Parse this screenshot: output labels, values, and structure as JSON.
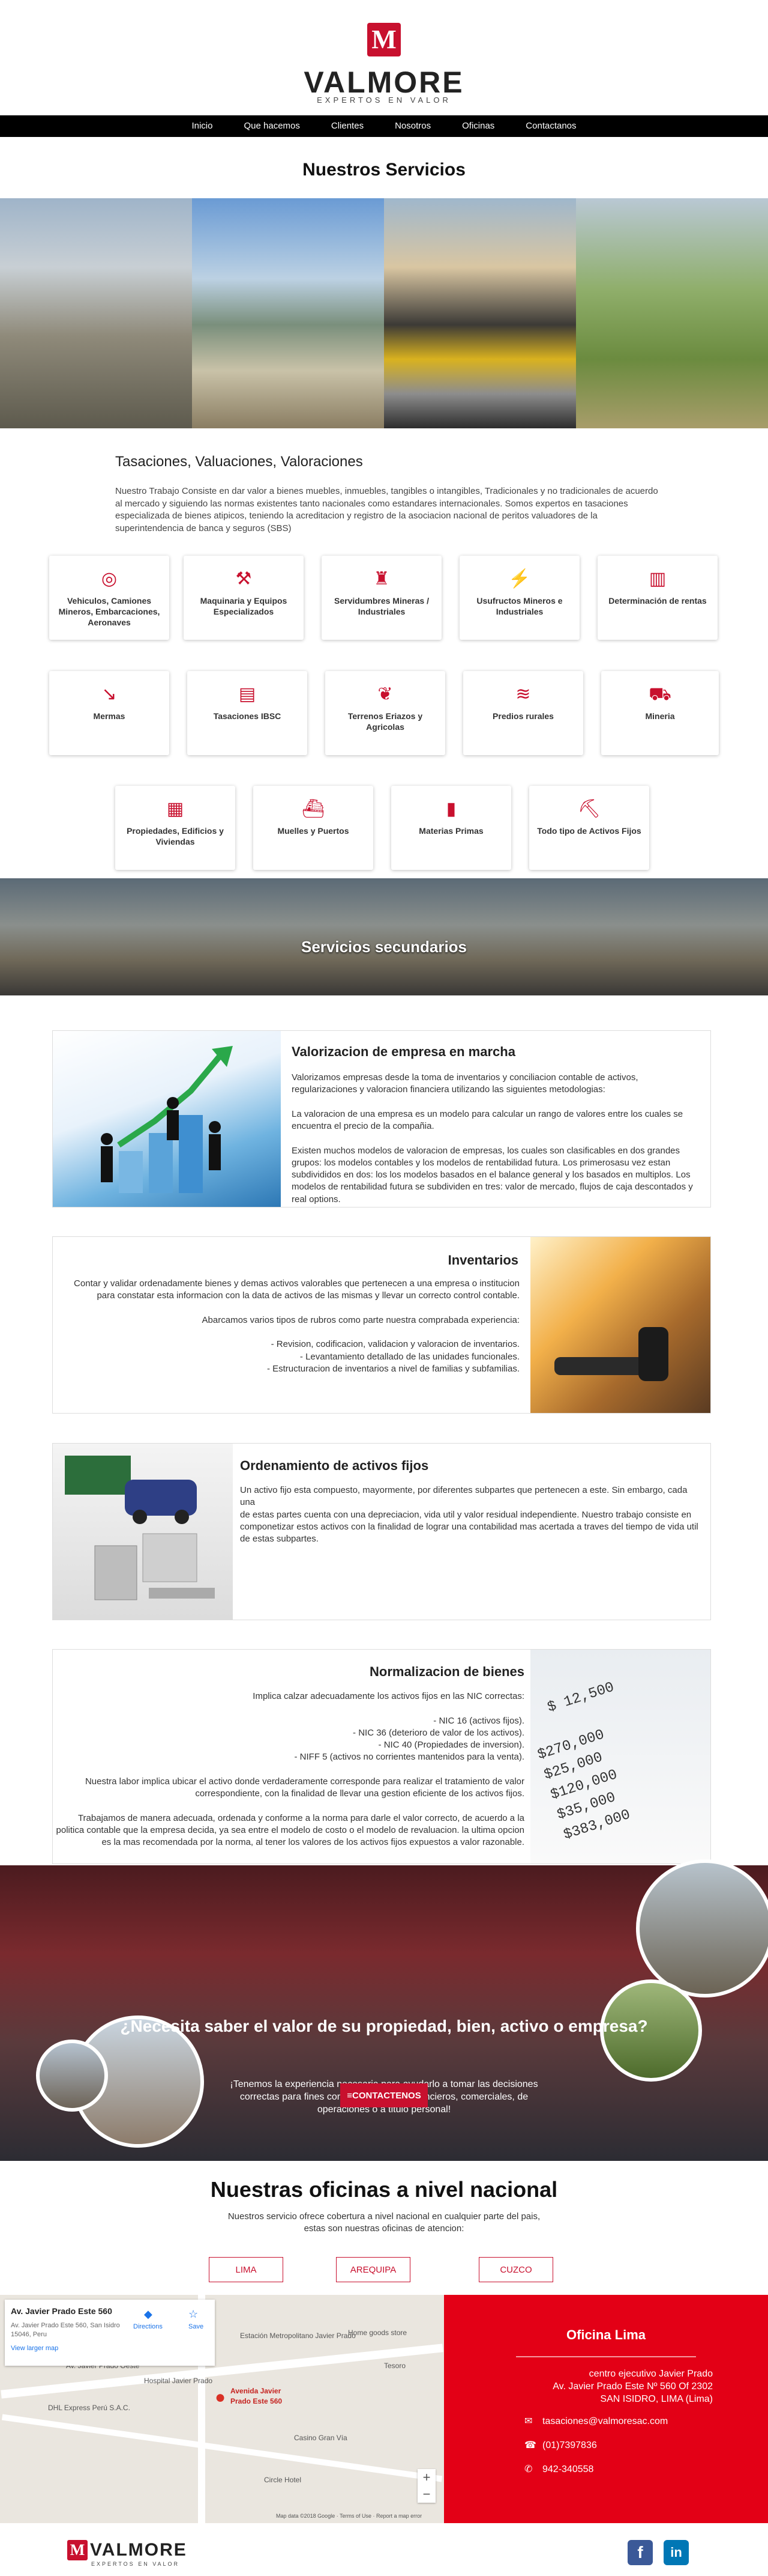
{
  "header": {
    "logo_letter": "M",
    "brand": "VALMORE",
    "tagline": "EXPERTOS EN VALOR"
  },
  "nav": [
    "Inicio",
    "Que hacemos",
    "Clientes",
    "Nosotros",
    "Oficinas",
    "Contactanos"
  ],
  "servicios_title": "Nuestros Servicios",
  "tasaciones_title": "Tasaciones, Valuaciones, Valoraciones",
  "intro": "Nuestro Trabajo Consiste en dar valor a bienes muebles, inmuebles, tangibles o intangibles, Tradicionales y no tradicionales de acuerdo al mercado y siguiendo las normas existentes tanto nacionales como estandares internacionales. Somos expertos en tasaciones especializada de bienes atipicos, teniendo la acreditacion y registro de la asociacion nacional de peritos valuadores de la superintendencia de banca y seguros (SBS)",
  "cards": [
    {
      "label": "Vehiculos, Camiones Mineros, Embarcaciones, Aeronaves",
      "icon": "target-icon"
    },
    {
      "label": "Maquinaria y Equipos Especializados",
      "icon": "tools-icon"
    },
    {
      "label": "Servidumbres Mineras / Industriales",
      "icon": "tower-icon"
    },
    {
      "label": "Usufructos Mineros e Industriales",
      "icon": "bolt-icon"
    },
    {
      "label": "Determinación de rentas",
      "icon": "building-icon"
    },
    {
      "label": "Mermas",
      "icon": "chart-down-icon"
    },
    {
      "label": "Tasaciones IBSC",
      "icon": "document-icon"
    },
    {
      "label": "Terrenos Eriazos y Agricolas",
      "icon": "plant-icon"
    },
    {
      "label": "Predios rurales",
      "icon": "field-icon"
    },
    {
      "label": "Mineria",
      "icon": "mining-cart-icon"
    },
    {
      "label": "Propiedades, Edificios y Viviendas",
      "icon": "city-icon"
    },
    {
      "label": "Muelles y Puertos",
      "icon": "ship-icon"
    },
    {
      "label": "Materias Primas",
      "icon": "phone-icon"
    },
    {
      "label": "Todo tipo de Activos Fijos",
      "icon": "excavator-icon"
    }
  ],
  "banner": "Servicios secundarios",
  "sections": [
    {
      "title": "Valorizacion de empresa en marcha",
      "text": "Valorizamos empresas desde la toma de inventarios y conciliacion contable de activos, regularizaciones y valoracion financiera utilizando las siguientes metodologias:\n\nLa valoracion de una empresa es un modelo para calcular un rango de valores entre los cuales se encuentra el precio de la compañia.\n\nExisten muchos modelos de valoracion de empresas, los cuales son clasificables en dos grandes grupos: los modelos contables y los modelos de rentabilidad futura. Los primerosasu vez estan subdivididos en dos: los los modelos basados en el balance general y los basados en multiplos. Los modelos de rentabilidad futura se subdividen en tres: valor de mercado, flujos de caja descontados y real options."
    },
    {
      "title": "Inventarios",
      "text": "Contar y validar ordenadamente bienes y demas activos valorables que pertenecen a una empresa o institucion para constatar esta informacion con la data de activos de las mismas y llevar un correcto control contable.\n\nAbarcamos varios tipos de rubros como parte nuestra comprabada experiencia:\n\n- Revision, codificacion, validacion y valoracion de inventarios.\n- Levantamiento detallado de las unidades funcionales.\n- Estructuracion de inventarios a nivel de familias y subfamilias."
    },
    {
      "title": "Ordenamiento de activos fijos",
      "text": "Un activo fijo esta compuesto, mayormente, por diferentes subpartes que pertenecen a este. Sin embargo, cada una\nde estas partes cuenta con una depreciacion, vida util y valor residual independiente. Nuestro trabajo consiste en componetizar estos activos con la finalidad de lograr una contabilidad mas acertada a traves del tiempo de vida util de estas subpartes."
    },
    {
      "title": "Normalizacion de bienes",
      "text": "Implica calzar adecuadamente los activos fijos en las NIC correctas:\n\n- NIC 16 (activos fijos).\n- NIC 36 (deterioro de valor de los activos).\n- NIC 40 (Propiedades de inversion).\n- NIFF 5 (activos no corrientes mantenidos para la venta).\n\nNuestra labor implica ubicar el activo donde verdaderamente corresponde para realizar el tratamiento de valor\ncorrespondiente, con la finalidad de llevar una gestion eficiente de los activos fijos.\n\nTrabajamos de manera adecuada, ordenada y conforme a la norma para darle el valor correcto, de acuerdo a la politica contable que la empresa decida, ya sea entre el modelo de costo o el modelo de revaluacion. la ultima opcion es la mas recomendada por la norma, al tener los valores de los activos fijos expuestos a valor razonable."
    }
  ],
  "cta": {
    "title": "¿Necesita saber el valor de su propiedad, bien, activo o empresa?",
    "text": "¡Tenemos la experiencia necesaria para ayudarlo a tomar las decisiones correctas para fines contables, legales, financieros, comerciales, de operaciones o a titulo personal!",
    "button": "≡CONTACTENOS"
  },
  "oficinas": {
    "title": "Nuestras oficinas a nivel nacional",
    "text": "Nuestros servicio ofrece cobertura a nivel nacional en cualquier parte del pais,\nestas son nuestras oficinas de atencion:",
    "buttons": [
      "LIMA",
      "AREQUIPA",
      "CUZCO"
    ]
  },
  "map": {
    "place": "Av. Javier Prado Este 560",
    "address": "Av. Javier Prado Este 560, San Isidro 15046, Peru",
    "view_larger": "View larger map",
    "directions": "Directions",
    "save": "Save",
    "pin": "Avenida Javier Prado Este 560",
    "footer": "Map data ©2018 Google · Terms of Use · Report a map error",
    "labels": [
      "Estación Metropolitano Javier Prado",
      "Home goods store",
      "Tesoro",
      "Hospital Javier Prado",
      "DHL Express Perú S.A.C.",
      "Casino Gran Vía",
      "Circle Hotel",
      "Av. Javier Prado Oeste"
    ]
  },
  "office": {
    "title": "Oficina Lima",
    "address": "centro ejecutivo Javier Prado\nAv. Javier Prado Este Nº 560 Of 2302\nSAN ISIDRO, LIMA (Lima)",
    "email": "tasaciones@valmoresac.com",
    "phone": "(01)7397836",
    "mobile": "942-340558"
  },
  "footer": {
    "brand": "VALMORE",
    "tagline": "EXPERTOS EN VALOR",
    "social": [
      "f",
      "in"
    ]
  },
  "colors": {
    "accent": "#c8102e",
    "office_bg": "#e30016",
    "nav_bg": "#000000",
    "facebook": "#3b5998",
    "linkedin": "#0077b5"
  }
}
